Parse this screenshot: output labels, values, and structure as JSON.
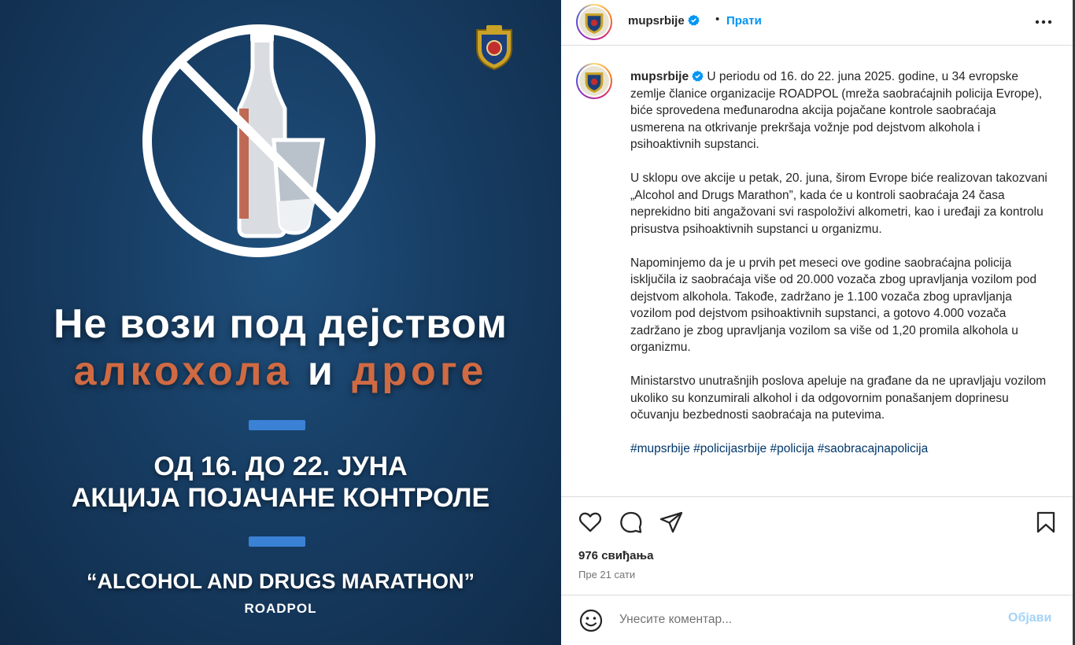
{
  "post_image": {
    "headline_line1": "Не вози под дејством",
    "headline_word1": "алкохола",
    "headline_conj": "и",
    "headline_word2": "дроге",
    "date_line": "ОД 16. ДО 22. ЈУНА",
    "action_line": "АКЦИЈА ПОЈАЧАНЕ КОНТРОЛЕ",
    "marathon_line": "“ALCOHOL AND DRUGS MARATHON”",
    "organization": "ROADPOL",
    "colors": {
      "accent": "#cf6a43",
      "background": "#173d63",
      "divider": "#3b82d6"
    }
  },
  "header": {
    "username": "mupsrbije",
    "separator": "•",
    "follow_label": "Прати",
    "verified_icon": "verified-badge-icon",
    "more_icon": "more-options-icon"
  },
  "caption": {
    "username": "mupsrbije",
    "paragraphs": [
      "U periodu od 16. do 22. juna 2025. godine, u 34 evropske zemlje članice organizacije ROADPOL (mreža saobraćajnih policija Evrope), biće sprovedena međunarodna akcija pojačane kontrole saobraćaja usmerena na otkrivanje prekršaja vožnje pod dejstvom alkohola i psihoaktivnih supstanci.",
      "U sklopu ove akcije u petak, 20. juna, širom Evrope biće realizovan takozvani „Alcohol and Drugs Marathon”, kada će u kontroli saobraćaja 24 časa neprekidno biti angažovani svi raspoloživi alkometri, kao i uređaji za kontrolu prisustva psihoaktivnih supstanci u organizmu.",
      "Napominjemo da je u prvih pet meseci ove godine saobraćajna policija isključila iz saobraćaja više od 20.000 vozača zbog upravljanja vozilom pod dejstvom alkohola. Takođe, zadržano je 1.100 vozača zbog upravljanja vozilom pod dejstvom psihoaktivnih supstanci, a gotovo 4.000 vozača zadržano je zbog upravljanja vozilom sa više od 1,20 promila alkohola u organizmu.",
      "Ministarstvo unutrašnjih poslova apeluje na građane da ne upravljaju vozilom ukoliko su konzumirali alkohol i da odgovornim ponašanjem doprinesu očuvanju bezbednosti saobraćaja na putevima.",
      "#mupsrbije #policijasrbije #policija #saobracajnapolicija"
    ]
  },
  "actions": {
    "like_icon": "heart-icon",
    "comment_icon": "comment-icon",
    "share_icon": "share-icon",
    "save_icon": "bookmark-icon",
    "likes_text": "976 свиђања",
    "time_text": "Пре 21 сати"
  },
  "comment_bar": {
    "emoji_icon": "emoji-icon",
    "placeholder": "Унесите коментар...",
    "post_label": "Објави",
    "post_color": "#a3d3f7"
  }
}
